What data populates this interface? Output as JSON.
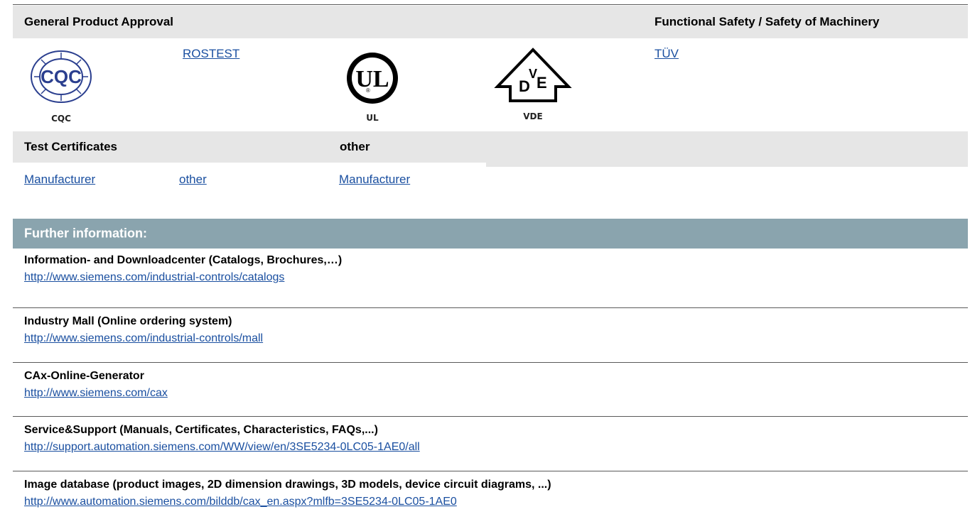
{
  "approvals": {
    "general_header": "General Product Approval",
    "safety_header": "Functional Safety / Safety of Machinery",
    "logos": {
      "cqc": {
        "caption": "CQC",
        "mark": "CQC"
      },
      "ul": {
        "caption": "UL",
        "mark": "UL",
        "registered": "®"
      },
      "vde": {
        "caption": "VDE",
        "mark_d": "D",
        "mark_v": "V",
        "mark_e": "E"
      }
    },
    "rostest_link": "ROSTEST",
    "tuv_link": "TÜV"
  },
  "certificates": {
    "test_header": "Test Certificates",
    "other_header": "other",
    "links": [
      "Manufacturer",
      "other",
      "Manufacturer"
    ]
  },
  "further": {
    "heading": "Further information:",
    "items": [
      {
        "title": "Information- and Downloadcenter (Catalogs, Brochures,…)",
        "url": "http://www.siemens.com/industrial-controls/catalogs"
      },
      {
        "title": "Industry Mall (Online ordering system)",
        "url": "http://www.siemens.com/industrial-controls/mall"
      },
      {
        "title": "CAx-Online-Generator",
        "url": "http://www.siemens.com/cax"
      },
      {
        "title": "Service&Support (Manuals, Certificates, Characteristics, FAQs,...)",
        "url": "http://support.automation.siemens.com/WW/view/en/3SE5234-0LC05-1AE0/all"
      },
      {
        "title": "Image database (product images, 2D dimension drawings, 3D models, device circuit diagrams, ...)",
        "url": "http://www.automation.siemens.com/bilddb/cax_en.aspx?mlfb=3SE5234-0LC05-1AE0"
      }
    ]
  },
  "colors": {
    "header_gray": "#e6e6e6",
    "further_bar": "#8aa4ae",
    "link": "#1a4fa0",
    "cqc_blue": "#2b3f8f"
  }
}
